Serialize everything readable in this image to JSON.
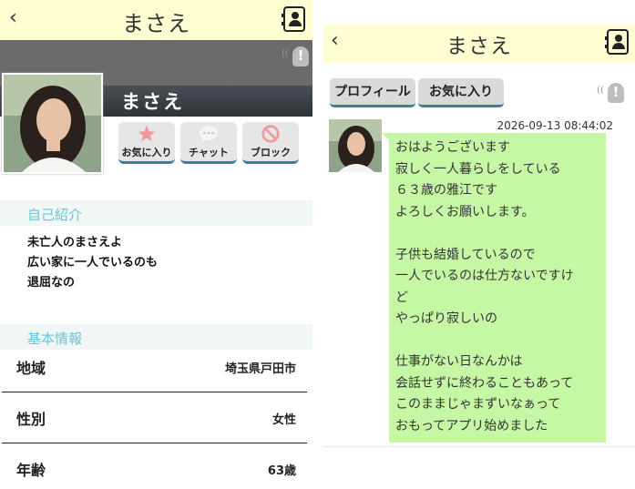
{
  "profile": {
    "name": "まさえ",
    "actions": [
      {
        "label": "お気に入り",
        "icon": "star-icon"
      },
      {
        "label": "チャット",
        "icon": "chat-bubble-icon"
      },
      {
        "label": "ブロック",
        "icon": "no-entry-icon"
      }
    ],
    "intro_header": "自己紹介",
    "intro_lines": [
      "未亡人のまさえよ",
      "広い家に一人でいるのも",
      "退屈なの"
    ],
    "info_header": "基本情報",
    "info": [
      {
        "key": "地域",
        "value": "埼玉県戸田市"
      },
      {
        "key": "性別",
        "value": "女性"
      },
      {
        "key": "年齢",
        "value": "63歳"
      }
    ]
  },
  "chat": {
    "name": "まさえ",
    "tabs": [
      "プロフィール",
      "お気に入り"
    ],
    "timestamp": "2026-09-13 08:44:02",
    "message": "おはようございます\n寂しく一人暮らしをしている\n６３歳の雅江です\nよろしくお願いします。\n\n子供も結婚しているので\n一人でいるのは仕方ないですけ\nど\nやっぱり寂しいの\n\n仕事がない日なんかは\n会話せずに終わることもあって\nこのままじゃまずいなぁって\nおもってアプリ始めました"
  },
  "icons": {
    "back": "‹",
    "report": "!"
  },
  "colors": {
    "header_bg": "#fefed2",
    "section_header_text": "#6fc3d9",
    "bubble_bg": "#c5f7a5",
    "button_border": "#3c7f95"
  }
}
